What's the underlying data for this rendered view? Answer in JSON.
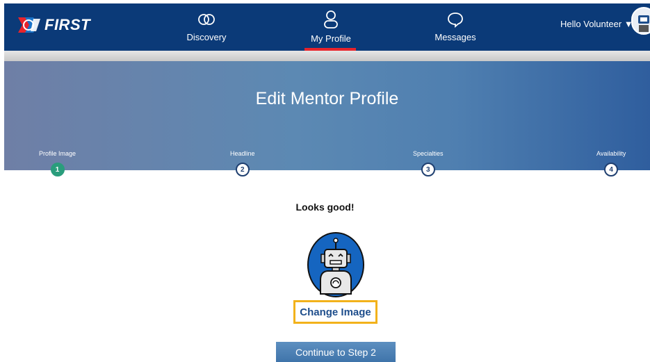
{
  "header": {
    "logo_text": "FIRST",
    "nav": [
      {
        "label": "Discovery",
        "icon": "discovery-rings-icon"
      },
      {
        "label": "My Profile",
        "icon": "person-icon",
        "active": true
      },
      {
        "label": "Messages",
        "icon": "chat-bubble-icon"
      }
    ],
    "user_greeting": "Hello Volunteer ▼",
    "accent_color": "#e8242b",
    "bar_color": "#0b3a78"
  },
  "banner": {
    "title": "Edit Mentor Profile",
    "steps": [
      {
        "label": "Profile Image",
        "number": "1",
        "status": "complete"
      },
      {
        "label": "Headline",
        "number": "2",
        "status": "pending"
      },
      {
        "label": "Specialties",
        "number": "3",
        "status": "pending"
      },
      {
        "label": "Availability",
        "number": "4",
        "status": "pending"
      }
    ]
  },
  "main": {
    "message": "Looks good!",
    "avatar_icon": "robot-avatar-icon",
    "change_image_label": "Change Image",
    "continue_label": "Continue to Step 2"
  }
}
